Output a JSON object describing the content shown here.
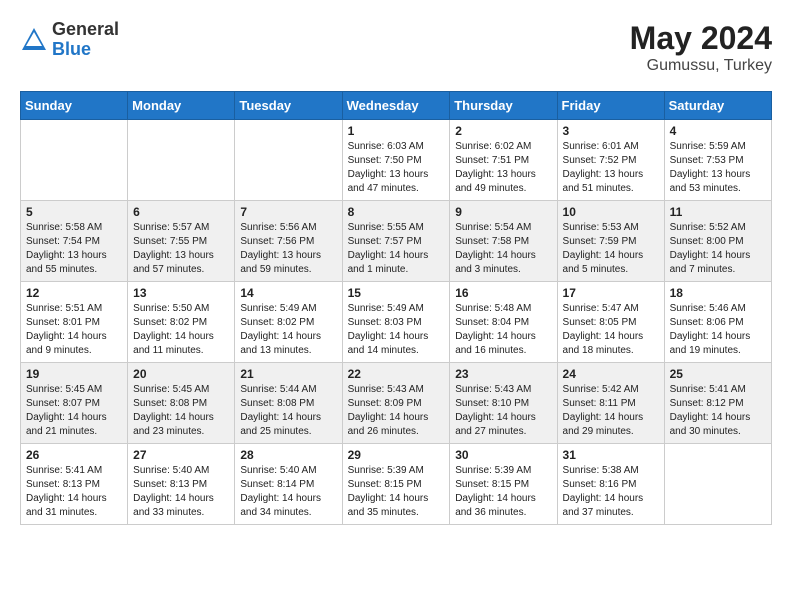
{
  "header": {
    "logo_general": "General",
    "logo_blue": "Blue",
    "month_year": "May 2024",
    "location": "Gumussu, Turkey"
  },
  "weekdays": [
    "Sunday",
    "Monday",
    "Tuesday",
    "Wednesday",
    "Thursday",
    "Friday",
    "Saturday"
  ],
  "weeks": [
    [
      {
        "day": "",
        "info": ""
      },
      {
        "day": "",
        "info": ""
      },
      {
        "day": "",
        "info": ""
      },
      {
        "day": "1",
        "info": "Sunrise: 6:03 AM\nSunset: 7:50 PM\nDaylight: 13 hours\nand 47 minutes."
      },
      {
        "day": "2",
        "info": "Sunrise: 6:02 AM\nSunset: 7:51 PM\nDaylight: 13 hours\nand 49 minutes."
      },
      {
        "day": "3",
        "info": "Sunrise: 6:01 AM\nSunset: 7:52 PM\nDaylight: 13 hours\nand 51 minutes."
      },
      {
        "day": "4",
        "info": "Sunrise: 5:59 AM\nSunset: 7:53 PM\nDaylight: 13 hours\nand 53 minutes."
      }
    ],
    [
      {
        "day": "5",
        "info": "Sunrise: 5:58 AM\nSunset: 7:54 PM\nDaylight: 13 hours\nand 55 minutes."
      },
      {
        "day": "6",
        "info": "Sunrise: 5:57 AM\nSunset: 7:55 PM\nDaylight: 13 hours\nand 57 minutes."
      },
      {
        "day": "7",
        "info": "Sunrise: 5:56 AM\nSunset: 7:56 PM\nDaylight: 13 hours\nand 59 minutes."
      },
      {
        "day": "8",
        "info": "Sunrise: 5:55 AM\nSunset: 7:57 PM\nDaylight: 14 hours\nand 1 minute."
      },
      {
        "day": "9",
        "info": "Sunrise: 5:54 AM\nSunset: 7:58 PM\nDaylight: 14 hours\nand 3 minutes."
      },
      {
        "day": "10",
        "info": "Sunrise: 5:53 AM\nSunset: 7:59 PM\nDaylight: 14 hours\nand 5 minutes."
      },
      {
        "day": "11",
        "info": "Sunrise: 5:52 AM\nSunset: 8:00 PM\nDaylight: 14 hours\nand 7 minutes."
      }
    ],
    [
      {
        "day": "12",
        "info": "Sunrise: 5:51 AM\nSunset: 8:01 PM\nDaylight: 14 hours\nand 9 minutes."
      },
      {
        "day": "13",
        "info": "Sunrise: 5:50 AM\nSunset: 8:02 PM\nDaylight: 14 hours\nand 11 minutes."
      },
      {
        "day": "14",
        "info": "Sunrise: 5:49 AM\nSunset: 8:02 PM\nDaylight: 14 hours\nand 13 minutes."
      },
      {
        "day": "15",
        "info": "Sunrise: 5:49 AM\nSunset: 8:03 PM\nDaylight: 14 hours\nand 14 minutes."
      },
      {
        "day": "16",
        "info": "Sunrise: 5:48 AM\nSunset: 8:04 PM\nDaylight: 14 hours\nand 16 minutes."
      },
      {
        "day": "17",
        "info": "Sunrise: 5:47 AM\nSunset: 8:05 PM\nDaylight: 14 hours\nand 18 minutes."
      },
      {
        "day": "18",
        "info": "Sunrise: 5:46 AM\nSunset: 8:06 PM\nDaylight: 14 hours\nand 19 minutes."
      }
    ],
    [
      {
        "day": "19",
        "info": "Sunrise: 5:45 AM\nSunset: 8:07 PM\nDaylight: 14 hours\nand 21 minutes."
      },
      {
        "day": "20",
        "info": "Sunrise: 5:45 AM\nSunset: 8:08 PM\nDaylight: 14 hours\nand 23 minutes."
      },
      {
        "day": "21",
        "info": "Sunrise: 5:44 AM\nSunset: 8:08 PM\nDaylight: 14 hours\nand 25 minutes."
      },
      {
        "day": "22",
        "info": "Sunrise: 5:43 AM\nSunset: 8:09 PM\nDaylight: 14 hours\nand 26 minutes."
      },
      {
        "day": "23",
        "info": "Sunrise: 5:43 AM\nSunset: 8:10 PM\nDaylight: 14 hours\nand 27 minutes."
      },
      {
        "day": "24",
        "info": "Sunrise: 5:42 AM\nSunset: 8:11 PM\nDaylight: 14 hours\nand 29 minutes."
      },
      {
        "day": "25",
        "info": "Sunrise: 5:41 AM\nSunset: 8:12 PM\nDaylight: 14 hours\nand 30 minutes."
      }
    ],
    [
      {
        "day": "26",
        "info": "Sunrise: 5:41 AM\nSunset: 8:13 PM\nDaylight: 14 hours\nand 31 minutes."
      },
      {
        "day": "27",
        "info": "Sunrise: 5:40 AM\nSunset: 8:13 PM\nDaylight: 14 hours\nand 33 minutes."
      },
      {
        "day": "28",
        "info": "Sunrise: 5:40 AM\nSunset: 8:14 PM\nDaylight: 14 hours\nand 34 minutes."
      },
      {
        "day": "29",
        "info": "Sunrise: 5:39 AM\nSunset: 8:15 PM\nDaylight: 14 hours\nand 35 minutes."
      },
      {
        "day": "30",
        "info": "Sunrise: 5:39 AM\nSunset: 8:15 PM\nDaylight: 14 hours\nand 36 minutes."
      },
      {
        "day": "31",
        "info": "Sunrise: 5:38 AM\nSunset: 8:16 PM\nDaylight: 14 hours\nand 37 minutes."
      },
      {
        "day": "",
        "info": ""
      }
    ]
  ]
}
